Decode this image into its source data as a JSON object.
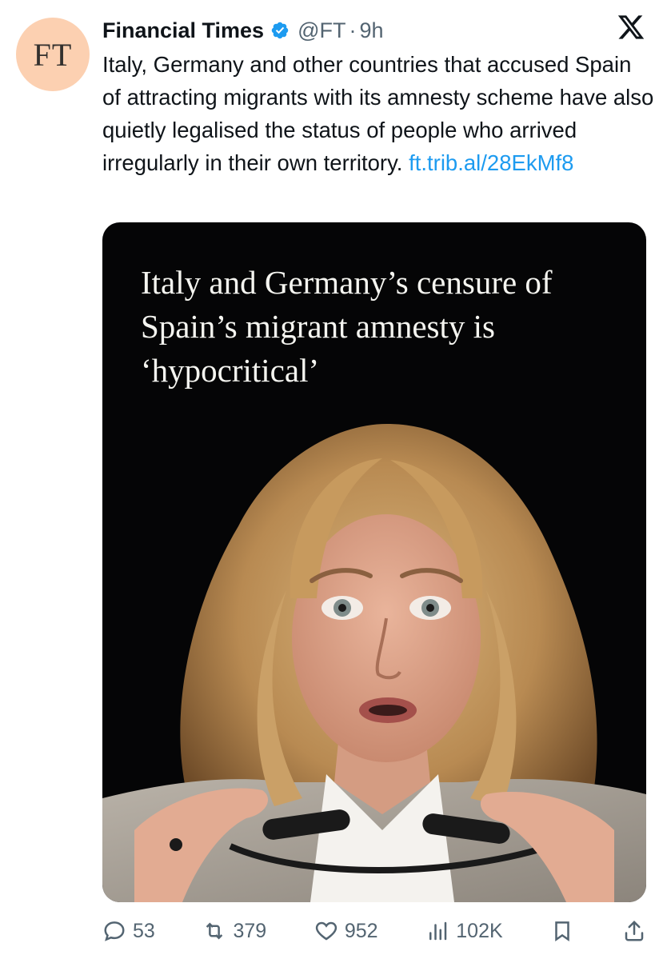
{
  "account": {
    "avatar_text": "FT",
    "name": "Financial Times",
    "handle": "@FT",
    "separator": "·",
    "time": "9h",
    "verified_icon": "verified-badge-icon"
  },
  "tweet": {
    "text": "Italy, Germany and other countries that accused Spain of attracting migrants with its amnesty scheme have also quietly legalised the status of people who arrived irregularly in their own territory.",
    "link": "ft.trib.al/28EkMf8"
  },
  "media": {
    "headline": "Italy and Germany’s censure of Spain’s migrant amnesty is ‘hypocritical’"
  },
  "actions": {
    "replies": "53",
    "reposts": "379",
    "likes": "952",
    "views": "102K"
  },
  "colors": {
    "link": "#1d9bf0",
    "muted": "#536471",
    "verified": "#1d9bf0",
    "ft_pink": "#fcd0b1"
  }
}
